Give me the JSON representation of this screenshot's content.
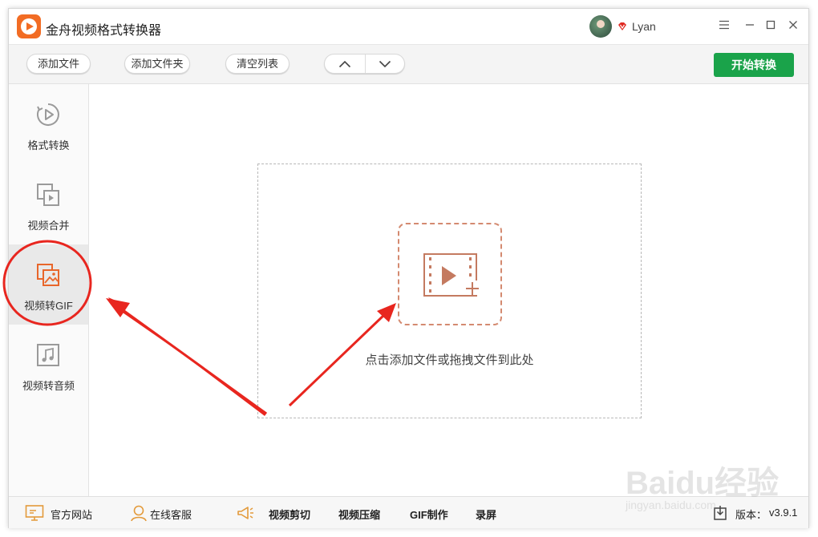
{
  "app": {
    "title": "金舟视频格式转换器",
    "user_name": "Lyan"
  },
  "toolbar": {
    "add_file": "添加文件",
    "add_folder": "添加文件夹",
    "clear_list": "清空列表",
    "start_convert": "开始转换"
  },
  "sidebar": {
    "items": [
      {
        "label": "格式转换",
        "icon": "format-convert-icon"
      },
      {
        "label": "视频合并",
        "icon": "video-merge-icon"
      },
      {
        "label": "视频转GIF",
        "icon": "video-to-gif-icon",
        "active": true
      },
      {
        "label": "视频转音频",
        "icon": "video-to-audio-icon"
      }
    ]
  },
  "main": {
    "drop_hint": "点击添加文件或拖拽文件到此处"
  },
  "status": {
    "official_site": "官方网站",
    "online_service": "在线客服",
    "video_cut": "视频剪切",
    "video_compress": "视频压缩",
    "gif_make": "GIF制作",
    "screen_record": "录屏",
    "version_label": "版本：",
    "version": "v3.9.1"
  },
  "watermark": {
    "brand": "Baidu经验",
    "url": "jingyan.baidu.com"
  },
  "colors": {
    "accent_green": "#1aa34a",
    "brand_orange": "#f26c24",
    "annotation_red": "#e8261f",
    "drop_border": "#d48a70"
  }
}
